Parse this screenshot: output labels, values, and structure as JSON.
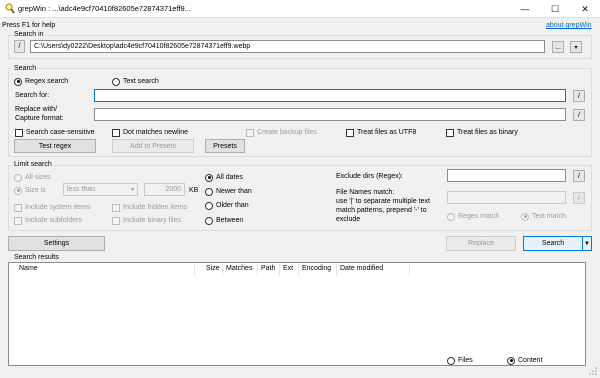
{
  "window": {
    "title": "grepWin : ...\\adc4e9cf70410f82605e72874371eff9...",
    "minimize": "—",
    "maximize": "☐",
    "close": "✕"
  },
  "header": {
    "help_text": "Press F1 for help",
    "about_link": "about grepWin"
  },
  "search_in": {
    "label": "Search in",
    "slash_button": "/",
    "path": "C:\\Users\\dy0222\\Desktop\\adc4e9cf70410f82605e72874371eff9.webp",
    "browse_button": "...",
    "dropdown_icon": "chevron-down-icon"
  },
  "search": {
    "label": "Search",
    "regex_radio": "Regex search",
    "text_radio": "Text search",
    "selected": "Regex search",
    "search_for_label": "Search for:",
    "search_for_value": "",
    "replace_label_1": "Replace with/",
    "replace_label_2": "Capture format:",
    "replace_value": "",
    "case_sensitive": "Search case-sensitive",
    "dot_matches_newline": "Dot matches newline",
    "create_backup": "Create backup files",
    "treat_utf8": "Treat files as UTF8",
    "treat_binary": "Treat files as binary",
    "test_regex_button": "Test regex",
    "add_to_presets_button": "Add to Presets",
    "presets_button": "Presets",
    "slash": "/"
  },
  "limit": {
    "label": "Limit search",
    "all_sizes": "All sizes",
    "size_is": "Size is",
    "size_compare": "less than",
    "size_value": "2000",
    "size_unit": "KB",
    "include_system": "Include system items",
    "include_hidden": "Include hidden items",
    "include_subfolders": "Include subfolders",
    "include_binary": "Include binary files",
    "all_dates": "All dates",
    "newer_than": "Newer than",
    "older_than": "Older than",
    "between": "Between",
    "selected_date": "All dates",
    "exclude_dirs_label": "Exclude dirs (Regex):",
    "exclude_dirs_value": "",
    "file_names_label": "File Names match:",
    "file_names_help_1": "use '|' to separate multiple text",
    "file_names_help_2": "match patterns, prepend '-' to",
    "file_names_help_3": "exclude",
    "file_names_value": "",
    "regex_match": "Regex match",
    "text_match": "Text match",
    "selected_match": "Text match",
    "slash": "/"
  },
  "actions": {
    "settings_button": "Settings",
    "replace_button": "Replace",
    "search_button": "Search",
    "search_dropdown_icon": "caret-down-icon"
  },
  "results": {
    "label": "Search results",
    "columns": [
      "Name",
      "Size",
      "Matches",
      "Path",
      "Ext",
      "Encoding",
      "Date modified"
    ],
    "rows": [],
    "files_radio": "Files",
    "content_radio": "Content",
    "selected_view": "Content"
  },
  "colors": {
    "accent": "#0078d7",
    "window_bg": "#f0f0f0",
    "link": "#0066cc"
  }
}
